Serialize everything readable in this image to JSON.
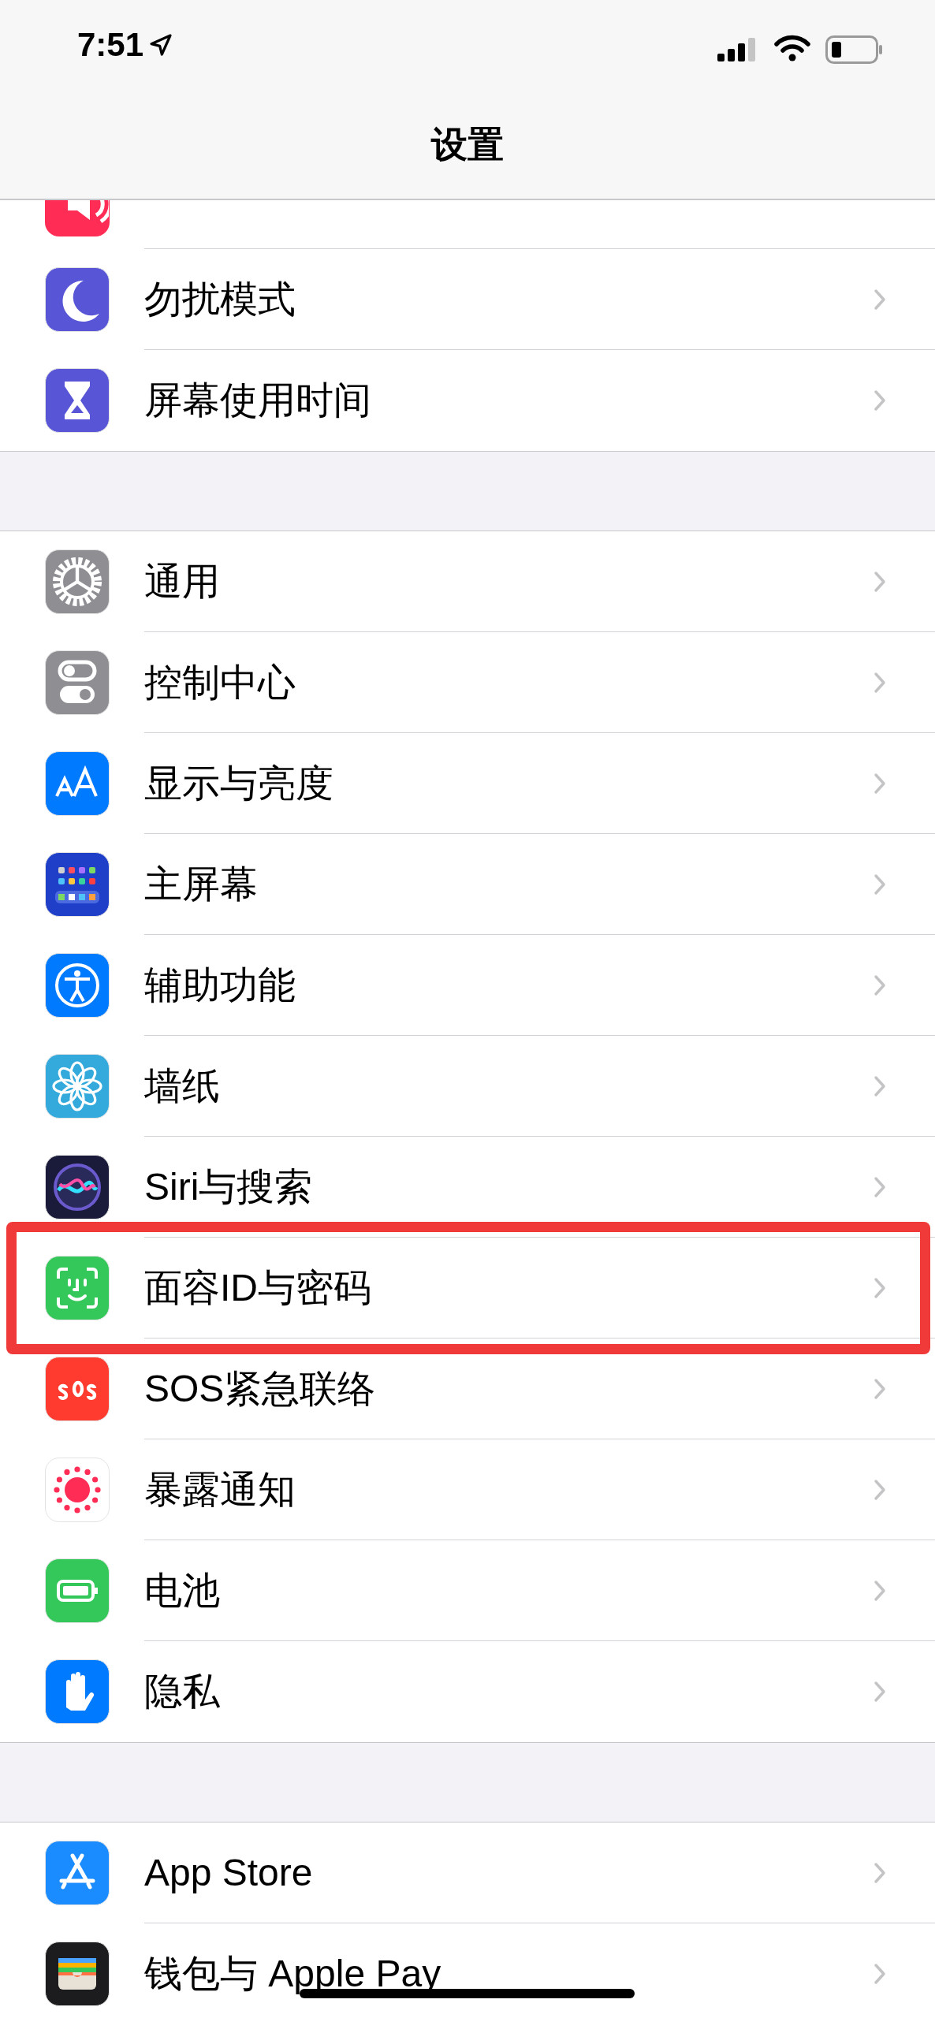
{
  "status_bar": {
    "time": "7:51"
  },
  "nav": {
    "title": "设置"
  },
  "groups": [
    {
      "rows": [
        {
          "kind": "sound",
          "highlighted": false
        },
        {
          "kind": "moon",
          "label": "勿扰模式",
          "highlighted": false
        },
        {
          "kind": "hourglass",
          "label": "屏幕使用时间",
          "highlighted": false
        }
      ]
    },
    {
      "rows": [
        {
          "kind": "gear",
          "label": "通用",
          "highlighted": false
        },
        {
          "kind": "toggles",
          "label": "控制中心",
          "highlighted": false
        },
        {
          "kind": "aa",
          "label": "显示与亮度",
          "highlighted": false
        },
        {
          "kind": "grid",
          "label": "主屏幕",
          "highlighted": false
        },
        {
          "kind": "person",
          "label": "辅助功能",
          "highlighted": false
        },
        {
          "kind": "flower",
          "label": "墙纸",
          "highlighted": false
        },
        {
          "kind": "siri",
          "label": "Siri与搜索",
          "highlighted": false
        },
        {
          "kind": "face",
          "label": "面容ID与密码",
          "highlighted": true
        },
        {
          "kind": "sos",
          "label": "SOS紧急联络",
          "highlighted": false
        },
        {
          "kind": "exposure",
          "label": "暴露通知",
          "highlighted": false
        },
        {
          "kind": "battery",
          "label": "电池",
          "highlighted": false
        },
        {
          "kind": "hand",
          "label": "隐私",
          "highlighted": false
        }
      ]
    },
    {
      "rows": [
        {
          "kind": "appstore",
          "label": "App Store",
          "highlighted": false
        },
        {
          "kind": "wallet",
          "label": "钱包与 Apple Pay",
          "highlighted": false
        }
      ]
    }
  ]
}
